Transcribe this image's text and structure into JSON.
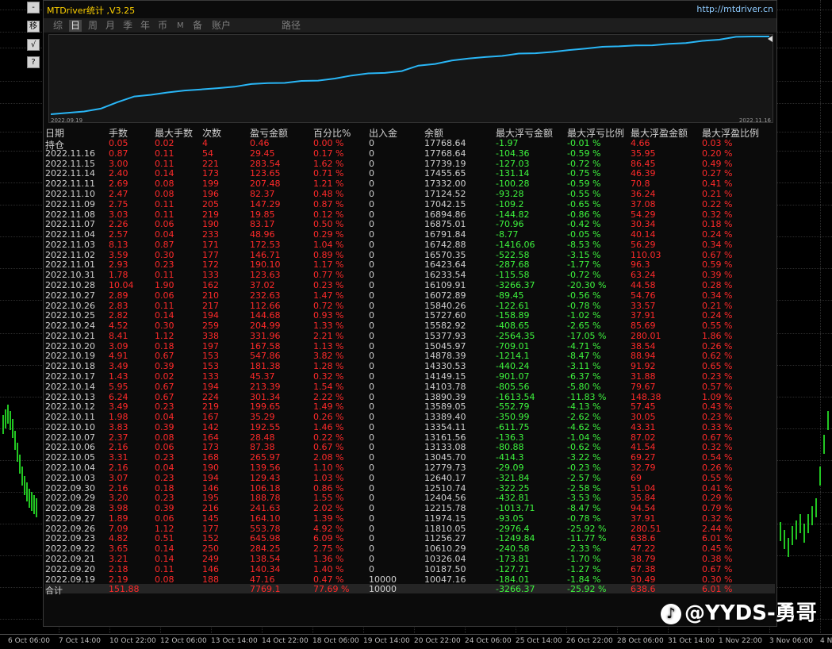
{
  "panel": {
    "title": "MTDriver统计 ,V3.25",
    "url": "http://mtdriver.cn",
    "tabs": [
      "综",
      "日",
      "周",
      "月",
      "季",
      "年",
      "币",
      "M",
      "备",
      "账户",
      "路径"
    ],
    "active_tab": "日"
  },
  "left_toolbar": {
    "buttons": [
      "-",
      "移",
      "√",
      "?"
    ]
  },
  "curve": {
    "start_date": "2022.09.19",
    "end_date": "2022.11.16",
    "line_color": "#29b6f6",
    "balances": [
      10047.16,
      10187.5,
      10326.04,
      10610.29,
      11256.27,
      11810.05,
      11974.15,
      12215.78,
      12404.56,
      12510.74,
      12640.17,
      12779.73,
      13045.7,
      13133.08,
      13161.56,
      13354.11,
      13389.4,
      13589.05,
      13890.39,
      14103.78,
      14149.15,
      14330.53,
      14878.39,
      15045.97,
      15377.93,
      15582.92,
      15727.6,
      15840.26,
      16072.89,
      16109.91,
      16233.54,
      16423.64,
      16570.35,
      16742.88,
      16791.84,
      16875.01,
      16894.86,
      17042.15,
      17124.52,
      17332.0,
      17455.65,
      17739.19,
      17768.64,
      17768.64
    ]
  },
  "table": {
    "headers": [
      "日期",
      "手数",
      "最大手数",
      "次数",
      "盈亏金额",
      "百分比%",
      "出入金",
      "余额",
      "最大浮亏金额",
      "最大浮亏比例",
      "最大浮盈金额",
      "最大浮盈比例"
    ],
    "rows": [
      [
        "持仓",
        "0.05",
        "0.02",
        "4",
        "0.46",
        "0.00 %",
        "0",
        "17768.64",
        "-1.97",
        "-0.01 %",
        "4.66",
        "0.03 %"
      ],
      [
        "2022.11.16",
        "0.87",
        "0.11",
        "54",
        "29.45",
        "0.17 %",
        "0",
        "17768.64",
        "-104.36",
        "-0.59 %",
        "35.95",
        "0.20 %"
      ],
      [
        "2022.11.15",
        "3.00",
        "0.11",
        "221",
        "283.54",
        "1.62 %",
        "0",
        "17739.19",
        "-127.03",
        "-0.72 %",
        "86.45",
        "0.49 %"
      ],
      [
        "2022.11.14",
        "2.40",
        "0.14",
        "173",
        "123.65",
        "0.71 %",
        "0",
        "17455.65",
        "-131.14",
        "-0.75 %",
        "46.39",
        "0.27 %"
      ],
      [
        "2022.11.11",
        "2.69",
        "0.08",
        "199",
        "207.48",
        "1.21 %",
        "0",
        "17332.00",
        "-100.28",
        "-0.59 %",
        "70.8",
        "0.41 %"
      ],
      [
        "2022.11.10",
        "2.47",
        "0.08",
        "196",
        "82.37",
        "0.48 %",
        "0",
        "17124.52",
        "-93.28",
        "-0.55 %",
        "36.24",
        "0.21 %"
      ],
      [
        "2022.11.09",
        "2.75",
        "0.11",
        "205",
        "147.29",
        "0.87 %",
        "0",
        "17042.15",
        "-109.2",
        "-0.65 %",
        "37.08",
        "0.22 %"
      ],
      [
        "2022.11.08",
        "3.03",
        "0.11",
        "219",
        "19.85",
        "0.12 %",
        "0",
        "16894.86",
        "-144.82",
        "-0.86 %",
        "54.29",
        "0.32 %"
      ],
      [
        "2022.11.07",
        "2.26",
        "0.06",
        "190",
        "83.17",
        "0.50 %",
        "0",
        "16875.01",
        "-70.96",
        "-0.42 %",
        "30.34",
        "0.18 %"
      ],
      [
        "2022.11.04",
        "2.57",
        "0.04",
        "233",
        "48.96",
        "0.29 %",
        "0",
        "16791.84",
        "-8.77",
        "-0.05 %",
        "40.14",
        "0.24 %"
      ],
      [
        "2022.11.03",
        "8.13",
        "0.87",
        "171",
        "172.53",
        "1.04 %",
        "0",
        "16742.88",
        "-1416.06",
        "-8.53 %",
        "56.29",
        "0.34 %"
      ],
      [
        "2022.11.02",
        "3.59",
        "0.30",
        "177",
        "146.71",
        "0.89 %",
        "0",
        "16570.35",
        "-522.58",
        "-3.15 %",
        "110.03",
        "0.67 %"
      ],
      [
        "2022.11.01",
        "2.93",
        "0.23",
        "172",
        "190.10",
        "1.17 %",
        "0",
        "16423.64",
        "-287.68",
        "-1.77 %",
        "96.3",
        "0.59 %"
      ],
      [
        "2022.10.31",
        "1.78",
        "0.11",
        "133",
        "123.63",
        "0.77 %",
        "0",
        "16233.54",
        "-115.58",
        "-0.72 %",
        "63.24",
        "0.39 %"
      ],
      [
        "2022.10.28",
        "10.04",
        "1.90",
        "162",
        "37.02",
        "0.23 %",
        "0",
        "16109.91",
        "-3266.37",
        "-20.30 %",
        "44.58",
        "0.28 %"
      ],
      [
        "2022.10.27",
        "2.89",
        "0.06",
        "210",
        "232.63",
        "1.47 %",
        "0",
        "16072.89",
        "-89.45",
        "-0.56 %",
        "54.76",
        "0.34 %"
      ],
      [
        "2022.10.26",
        "2.83",
        "0.11",
        "217",
        "112.66",
        "0.72 %",
        "0",
        "15840.26",
        "-122.61",
        "-0.78 %",
        "33.57",
        "0.21 %"
      ],
      [
        "2022.10.25",
        "2.82",
        "0.14",
        "194",
        "144.68",
        "0.93 %",
        "0",
        "15727.60",
        "-158.89",
        "-1.02 %",
        "37.91",
        "0.24 %"
      ],
      [
        "2022.10.24",
        "4.52",
        "0.30",
        "259",
        "204.99",
        "1.33 %",
        "0",
        "15582.92",
        "-408.65",
        "-2.65 %",
        "85.69",
        "0.55 %"
      ],
      [
        "2022.10.21",
        "8.41",
        "1.12",
        "338",
        "331.96",
        "2.21 %",
        "0",
        "15377.93",
        "-2564.35",
        "-17.05 %",
        "280.01",
        "1.86 %"
      ],
      [
        "2022.10.20",
        "3.09",
        "0.18",
        "197",
        "167.58",
        "1.13 %",
        "0",
        "15045.97",
        "-709.01",
        "-4.71 %",
        "38.54",
        "0.26 %"
      ],
      [
        "2022.10.19",
        "4.91",
        "0.67",
        "153",
        "547.86",
        "3.82 %",
        "0",
        "14878.39",
        "-1214.1",
        "-8.47 %",
        "88.94",
        "0.62 %"
      ],
      [
        "2022.10.18",
        "3.49",
        "0.39",
        "153",
        "181.38",
        "1.28 %",
        "0",
        "14330.53",
        "-440.24",
        "-3.11 %",
        "91.92",
        "0.65 %"
      ],
      [
        "2022.10.17",
        "1.43",
        "0.02",
        "133",
        "45.37",
        "0.32 %",
        "0",
        "14149.15",
        "-901.07",
        "-6.37 %",
        "31.88",
        "0.23 %"
      ],
      [
        "2022.10.14",
        "5.95",
        "0.67",
        "194",
        "213.39",
        "1.54 %",
        "0",
        "14103.78",
        "-805.56",
        "-5.80 %",
        "79.67",
        "0.57 %"
      ],
      [
        "2022.10.13",
        "6.24",
        "0.67",
        "224",
        "301.34",
        "2.22 %",
        "0",
        "13890.39",
        "-1613.54",
        "-11.83 %",
        "148.38",
        "1.09 %"
      ],
      [
        "2022.10.12",
        "3.49",
        "0.23",
        "219",
        "199.65",
        "1.49 %",
        "0",
        "13589.05",
        "-552.79",
        "-4.13 %",
        "57.45",
        "0.43 %"
      ],
      [
        "2022.10.11",
        "1.98",
        "0.04",
        "167",
        "35.29",
        "0.26 %",
        "0",
        "13389.40",
        "-350.99",
        "-2.62 %",
        "30.05",
        "0.23 %"
      ],
      [
        "2022.10.10",
        "3.83",
        "0.39",
        "142",
        "192.55",
        "1.46 %",
        "0",
        "13354.11",
        "-611.75",
        "-4.62 %",
        "43.31",
        "0.33 %"
      ],
      [
        "2022.10.07",
        "2.37",
        "0.08",
        "164",
        "28.48",
        "0.22 %",
        "0",
        "13161.56",
        "-136.3",
        "-1.04 %",
        "87.02",
        "0.67 %"
      ],
      [
        "2022.10.06",
        "2.16",
        "0.06",
        "173",
        "87.38",
        "0.67 %",
        "0",
        "13133.08",
        "-80.88",
        "-0.62 %",
        "41.54",
        "0.32 %"
      ],
      [
        "2022.10.05",
        "3.31",
        "0.23",
        "168",
        "265.97",
        "2.08 %",
        "0",
        "13045.70",
        "-414.3",
        "-3.22 %",
        "69.27",
        "0.54 %"
      ],
      [
        "2022.10.04",
        "2.16",
        "0.04",
        "190",
        "139.56",
        "1.10 %",
        "0",
        "12779.73",
        "-29.09",
        "-0.23 %",
        "32.79",
        "0.26 %"
      ],
      [
        "2022.10.03",
        "3.07",
        "0.23",
        "194",
        "129.43",
        "1.03 %",
        "0",
        "12640.17",
        "-321.84",
        "-2.57 %",
        "69",
        "0.55 %"
      ],
      [
        "2022.09.30",
        "2.16",
        "0.18",
        "146",
        "106.18",
        "0.86 %",
        "0",
        "12510.74",
        "-322.25",
        "-2.58 %",
        "51.04",
        "0.41 %"
      ],
      [
        "2022.09.29",
        "3.20",
        "0.23",
        "195",
        "188.78",
        "1.55 %",
        "0",
        "12404.56",
        "-432.81",
        "-3.53 %",
        "35.84",
        "0.29 %"
      ],
      [
        "2022.09.28",
        "3.98",
        "0.39",
        "216",
        "241.63",
        "2.02 %",
        "0",
        "12215.78",
        "-1013.71",
        "-8.47 %",
        "94.54",
        "0.79 %"
      ],
      [
        "2022.09.27",
        "1.89",
        "0.06",
        "145",
        "164.10",
        "1.39 %",
        "0",
        "11974.15",
        "-93.05",
        "-0.78 %",
        "37.91",
        "0.32 %"
      ],
      [
        "2022.09.26",
        "7.09",
        "1.12",
        "177",
        "553.78",
        "4.92 %",
        "0",
        "11810.05",
        "-2976.4",
        "-25.92 %",
        "280.51",
        "2.44 %"
      ],
      [
        "2022.09.23",
        "4.82",
        "0.51",
        "152",
        "645.98",
        "6.09 %",
        "0",
        "11256.27",
        "-1249.84",
        "-11.77 %",
        "638.6",
        "6.01 %"
      ],
      [
        "2022.09.22",
        "3.65",
        "0.14",
        "250",
        "284.25",
        "2.75 %",
        "0",
        "10610.29",
        "-240.58",
        "-2.33 %",
        "47.22",
        "0.45 %"
      ],
      [
        "2022.09.21",
        "3.21",
        "0.14",
        "249",
        "138.54",
        "1.36 %",
        "0",
        "10326.04",
        "-173.81",
        "-1.70 %",
        "38.79",
        "0.38 %"
      ],
      [
        "2022.09.20",
        "2.18",
        "0.11",
        "146",
        "140.34",
        "1.40 %",
        "0",
        "10187.50",
        "-127.71",
        "-1.27 %",
        "67.38",
        "0.67 %"
      ],
      [
        "2022.09.19",
        "2.19",
        "0.08",
        "188",
        "47.16",
        "0.47 %",
        "10000",
        "10047.16",
        "-184.01",
        "-1.84 %",
        "30.49",
        "0.30 %"
      ]
    ],
    "total_row": [
      "合计",
      "151.88",
      "",
      "",
      "7769.1",
      "77.69 %",
      "10000",
      "",
      "-3266.37",
      "-25.92 %",
      "638.6",
      "6.01 %"
    ]
  },
  "time_axis": [
    "6 Oct 06:00",
    "7 Oct 14:00",
    "10 Oct 22:00",
    "12 Oct 06:00",
    "13 Oct 14:00",
    "14 Oct 22:00",
    "18 Oct 06:00",
    "19 Oct 14:00",
    "20 Oct 22:00",
    "24 Oct 06:00",
    "25 Oct 14:00",
    "26 Oct 22:00",
    "28 Oct 06:00",
    "31 Oct 14:00",
    "1 Nov 22:00",
    "3 Nov 06:00",
    "4 N"
  ],
  "watermark": {
    "logo_icon": "social-app-logo",
    "text": "@YYDS-勇哥"
  },
  "colors": {
    "positive": "#ff2a2a",
    "negative": "#3ef53e",
    "chart_green": "#22c622"
  }
}
